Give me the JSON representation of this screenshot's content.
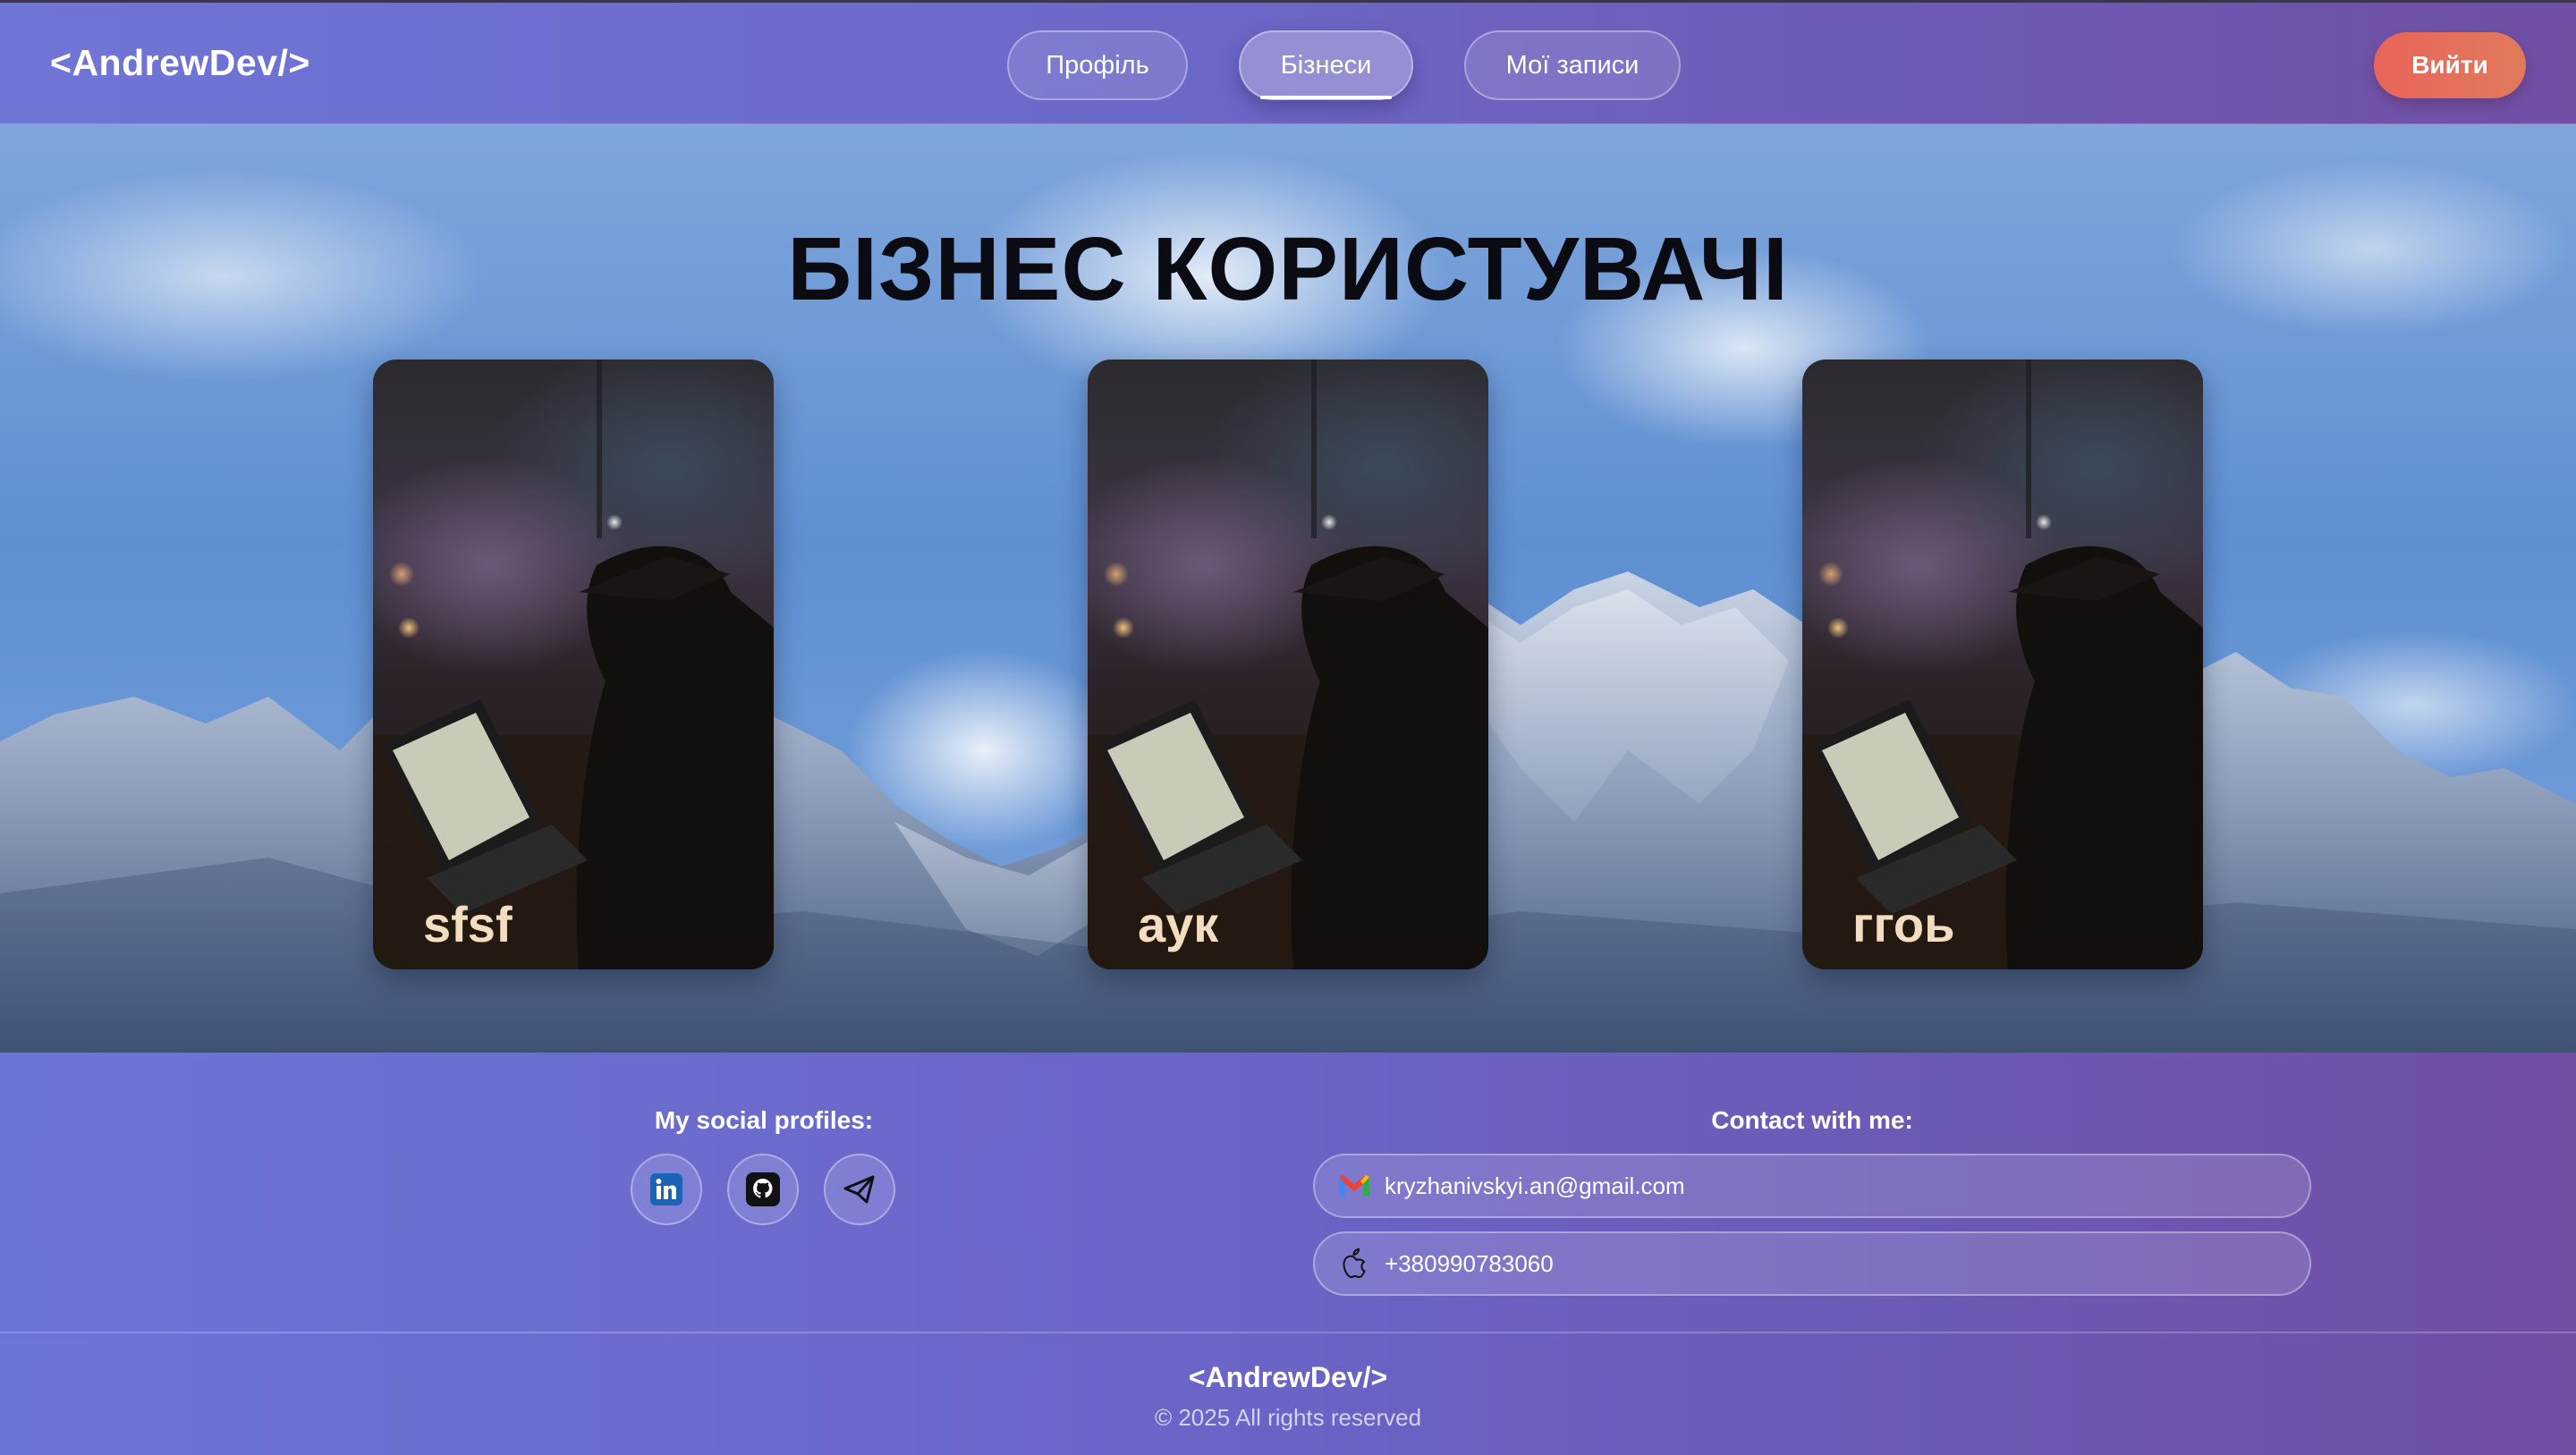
{
  "header": {
    "logo": "<AndrewDev/>",
    "nav": [
      {
        "label": "Профіль",
        "active": false
      },
      {
        "label": "Бізнеси",
        "active": true
      },
      {
        "label": "Мої записи",
        "active": false
      }
    ],
    "logout_label": "Вийти"
  },
  "hero": {
    "title": "БІЗНЕС КОРИСТУВАЧІ",
    "cards": [
      {
        "name": "sfsf"
      },
      {
        "name": "аук"
      },
      {
        "name": "ггоь"
      }
    ]
  },
  "footer": {
    "social_title": "My social profiles:",
    "social_icons": [
      "linkedin-icon",
      "github-icon",
      "telegram-icon"
    ],
    "contact_title": "Contact with me:",
    "email": "kryzhanivskyi.an@gmail.com",
    "phone": "+380990783060",
    "logo": "<AndrewDev/>",
    "copyright": "© 2025 All rights reserved"
  },
  "colors": {
    "header_gradient_start": "#6f75d6",
    "header_gradient_end": "#704fa5",
    "logout_button": "#e8645a",
    "title_text": "#0b0b14",
    "card_name": "#f3ddc0"
  }
}
